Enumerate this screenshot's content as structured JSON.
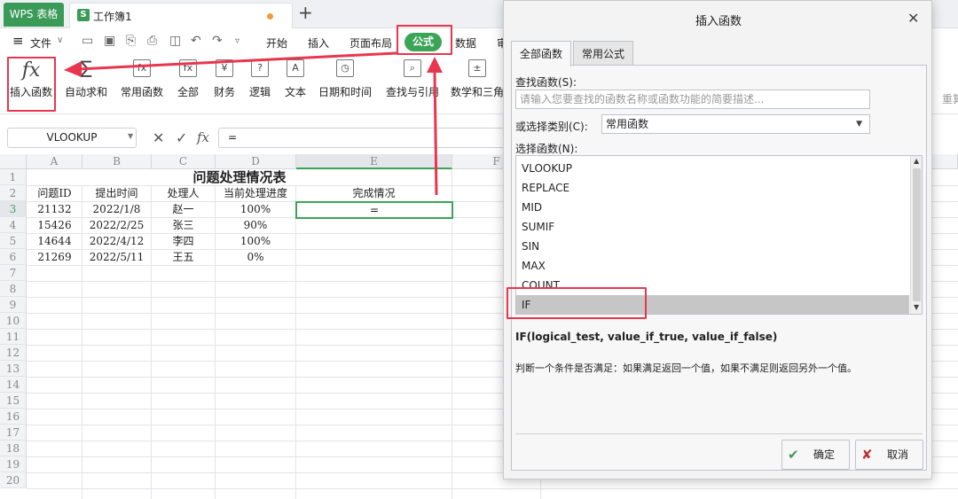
{
  "titlebar": {
    "app_tab": "WPS 表格",
    "book_tab": "工作簿1",
    "book_icon": "S",
    "new_tab": "+"
  },
  "menu": {
    "hamburger": "≡",
    "file": "文件",
    "items": [
      "开始",
      "插入",
      "页面布局",
      "公式",
      "数据",
      "审"
    ]
  },
  "ribbon": {
    "insert_fn": "插入函数",
    "autosum": "自动求和",
    "common": "常用函数",
    "all": "全部",
    "finance": "财务",
    "logic": "逻辑",
    "text": "文本",
    "datetime": "日期和时间",
    "lookup": "查找与引用",
    "math": "数学和三角",
    "right_cut": "重算"
  },
  "formulabar": {
    "namebox": "VLOOKUP",
    "content": "="
  },
  "sheet": {
    "columns": [
      "A",
      "B",
      "C",
      "D",
      "E",
      "F"
    ],
    "rows": [
      "1",
      "2",
      "3",
      "4",
      "5",
      "6",
      "7",
      "8",
      "9",
      "10",
      "11",
      "12",
      "13",
      "14",
      "15",
      "16",
      "17",
      "18",
      "19",
      "20"
    ],
    "title": "问题处理情况表",
    "headers": [
      "问题ID",
      "提出时间",
      "处理人",
      "当前处理进度",
      "完成情况"
    ],
    "data": [
      [
        "21132",
        "2022/1/8",
        "赵一",
        "100%",
        "="
      ],
      [
        "15426",
        "2022/2/25",
        "张三",
        "90%",
        ""
      ],
      [
        "14644",
        "2022/4/12",
        "李四",
        "100%",
        ""
      ],
      [
        "21269",
        "2022/5/11",
        "王五",
        "0%",
        ""
      ]
    ]
  },
  "dialog": {
    "title": "插入函数",
    "tab_all": "全部函数",
    "tab_common": "常用公式",
    "find_label": "查找函数(S):",
    "find_placeholder": "请输入您要查找的函数名称或函数功能的简要描述...",
    "category_label": "或选择类别(C):",
    "category_value": "常用函数",
    "select_label": "选择函数(N):",
    "functions": [
      "VLOOKUP",
      "REPLACE",
      "MID",
      "SUMIF",
      "SIN",
      "MAX",
      "COUNT",
      "IF"
    ],
    "selected": "IF",
    "syntax": "IF(logical_test, value_if_true, value_if_false)",
    "description": "判断一个条件是否满足：如果满足返回一个值，如果不满足则返回另外一个值。",
    "ok": "确定",
    "cancel": "取消"
  },
  "colors": {
    "accent": "#3aa557",
    "annotation": "#e8364f",
    "wps_green": "#3a9a58"
  }
}
